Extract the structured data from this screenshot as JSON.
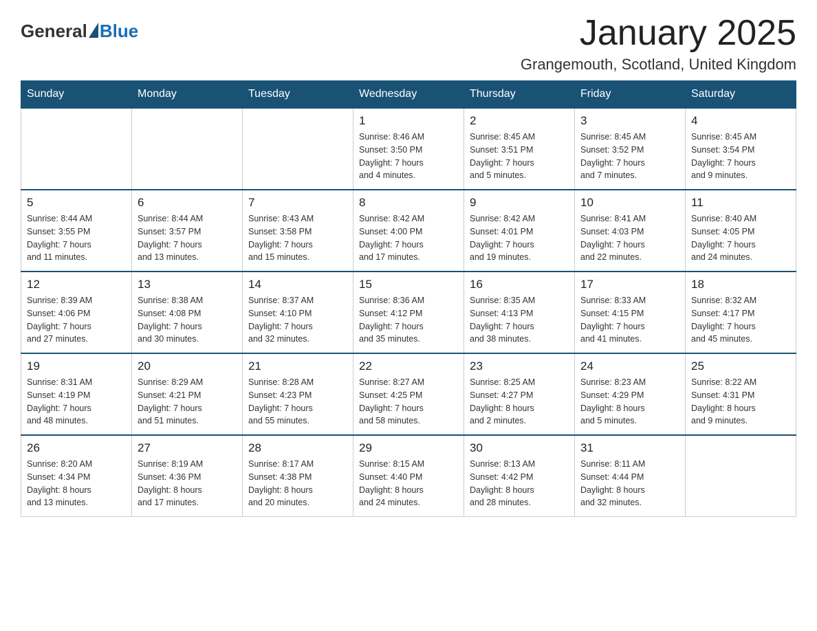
{
  "header": {
    "logo_general": "General",
    "logo_blue": "Blue",
    "title": "January 2025",
    "subtitle": "Grangemouth, Scotland, United Kingdom"
  },
  "days_of_week": [
    "Sunday",
    "Monday",
    "Tuesday",
    "Wednesday",
    "Thursday",
    "Friday",
    "Saturday"
  ],
  "weeks": [
    [
      {
        "day": "",
        "info": ""
      },
      {
        "day": "",
        "info": ""
      },
      {
        "day": "",
        "info": ""
      },
      {
        "day": "1",
        "info": "Sunrise: 8:46 AM\nSunset: 3:50 PM\nDaylight: 7 hours\nand 4 minutes."
      },
      {
        "day": "2",
        "info": "Sunrise: 8:45 AM\nSunset: 3:51 PM\nDaylight: 7 hours\nand 5 minutes."
      },
      {
        "day": "3",
        "info": "Sunrise: 8:45 AM\nSunset: 3:52 PM\nDaylight: 7 hours\nand 7 minutes."
      },
      {
        "day": "4",
        "info": "Sunrise: 8:45 AM\nSunset: 3:54 PM\nDaylight: 7 hours\nand 9 minutes."
      }
    ],
    [
      {
        "day": "5",
        "info": "Sunrise: 8:44 AM\nSunset: 3:55 PM\nDaylight: 7 hours\nand 11 minutes."
      },
      {
        "day": "6",
        "info": "Sunrise: 8:44 AM\nSunset: 3:57 PM\nDaylight: 7 hours\nand 13 minutes."
      },
      {
        "day": "7",
        "info": "Sunrise: 8:43 AM\nSunset: 3:58 PM\nDaylight: 7 hours\nand 15 minutes."
      },
      {
        "day": "8",
        "info": "Sunrise: 8:42 AM\nSunset: 4:00 PM\nDaylight: 7 hours\nand 17 minutes."
      },
      {
        "day": "9",
        "info": "Sunrise: 8:42 AM\nSunset: 4:01 PM\nDaylight: 7 hours\nand 19 minutes."
      },
      {
        "day": "10",
        "info": "Sunrise: 8:41 AM\nSunset: 4:03 PM\nDaylight: 7 hours\nand 22 minutes."
      },
      {
        "day": "11",
        "info": "Sunrise: 8:40 AM\nSunset: 4:05 PM\nDaylight: 7 hours\nand 24 minutes."
      }
    ],
    [
      {
        "day": "12",
        "info": "Sunrise: 8:39 AM\nSunset: 4:06 PM\nDaylight: 7 hours\nand 27 minutes."
      },
      {
        "day": "13",
        "info": "Sunrise: 8:38 AM\nSunset: 4:08 PM\nDaylight: 7 hours\nand 30 minutes."
      },
      {
        "day": "14",
        "info": "Sunrise: 8:37 AM\nSunset: 4:10 PM\nDaylight: 7 hours\nand 32 minutes."
      },
      {
        "day": "15",
        "info": "Sunrise: 8:36 AM\nSunset: 4:12 PM\nDaylight: 7 hours\nand 35 minutes."
      },
      {
        "day": "16",
        "info": "Sunrise: 8:35 AM\nSunset: 4:13 PM\nDaylight: 7 hours\nand 38 minutes."
      },
      {
        "day": "17",
        "info": "Sunrise: 8:33 AM\nSunset: 4:15 PM\nDaylight: 7 hours\nand 41 minutes."
      },
      {
        "day": "18",
        "info": "Sunrise: 8:32 AM\nSunset: 4:17 PM\nDaylight: 7 hours\nand 45 minutes."
      }
    ],
    [
      {
        "day": "19",
        "info": "Sunrise: 8:31 AM\nSunset: 4:19 PM\nDaylight: 7 hours\nand 48 minutes."
      },
      {
        "day": "20",
        "info": "Sunrise: 8:29 AM\nSunset: 4:21 PM\nDaylight: 7 hours\nand 51 minutes."
      },
      {
        "day": "21",
        "info": "Sunrise: 8:28 AM\nSunset: 4:23 PM\nDaylight: 7 hours\nand 55 minutes."
      },
      {
        "day": "22",
        "info": "Sunrise: 8:27 AM\nSunset: 4:25 PM\nDaylight: 7 hours\nand 58 minutes."
      },
      {
        "day": "23",
        "info": "Sunrise: 8:25 AM\nSunset: 4:27 PM\nDaylight: 8 hours\nand 2 minutes."
      },
      {
        "day": "24",
        "info": "Sunrise: 8:23 AM\nSunset: 4:29 PM\nDaylight: 8 hours\nand 5 minutes."
      },
      {
        "day": "25",
        "info": "Sunrise: 8:22 AM\nSunset: 4:31 PM\nDaylight: 8 hours\nand 9 minutes."
      }
    ],
    [
      {
        "day": "26",
        "info": "Sunrise: 8:20 AM\nSunset: 4:34 PM\nDaylight: 8 hours\nand 13 minutes."
      },
      {
        "day": "27",
        "info": "Sunrise: 8:19 AM\nSunset: 4:36 PM\nDaylight: 8 hours\nand 17 minutes."
      },
      {
        "day": "28",
        "info": "Sunrise: 8:17 AM\nSunset: 4:38 PM\nDaylight: 8 hours\nand 20 minutes."
      },
      {
        "day": "29",
        "info": "Sunrise: 8:15 AM\nSunset: 4:40 PM\nDaylight: 8 hours\nand 24 minutes."
      },
      {
        "day": "30",
        "info": "Sunrise: 8:13 AM\nSunset: 4:42 PM\nDaylight: 8 hours\nand 28 minutes."
      },
      {
        "day": "31",
        "info": "Sunrise: 8:11 AM\nSunset: 4:44 PM\nDaylight: 8 hours\nand 32 minutes."
      },
      {
        "day": "",
        "info": ""
      }
    ]
  ]
}
